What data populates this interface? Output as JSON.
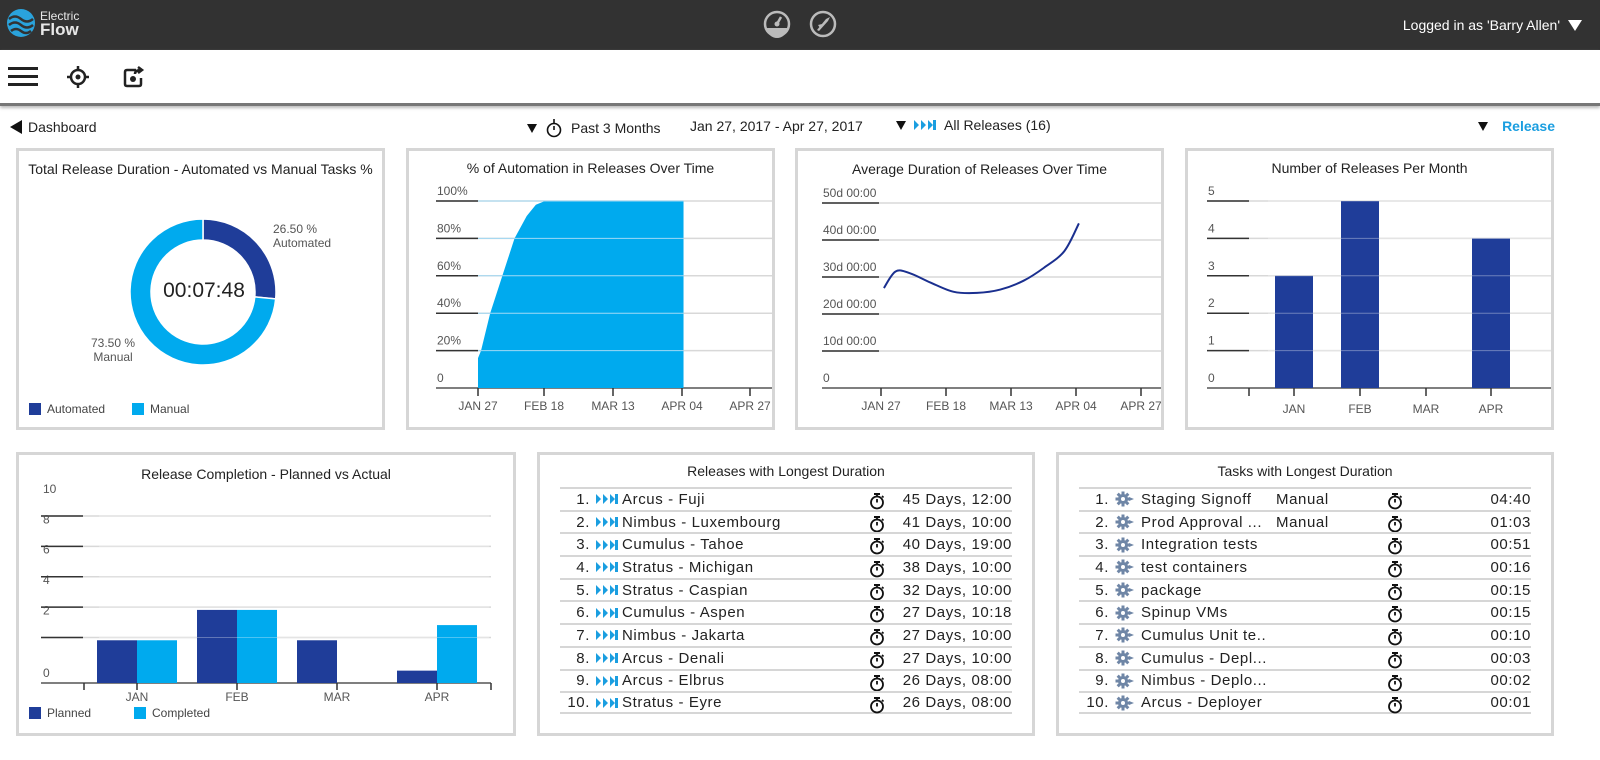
{
  "app": {
    "logo_line1": "Electric",
    "logo_line2": "Flow",
    "user_label": "Logged in as 'Barry Allen'",
    "top_icons": [
      "dashboard-gauge-icon",
      "release-rocket-icon"
    ],
    "toolbar_icons": [
      "menu-icon",
      "target-icon",
      "refresh-icon"
    ]
  },
  "colors": {
    "dark": "#1f3d99",
    "light": "#00aaee",
    "accent": "#1a9ee0",
    "topbar": "#323232"
  },
  "filters": {
    "back_label": "Dashboard",
    "time_range": "Past 3 Months",
    "date_range": "Jan 27, 2017 - Apr 27, 2017",
    "releases_filter": "All Releases (16)",
    "group_by": "Release"
  },
  "panels": {
    "donut": {
      "title": "Total Release Duration - Automated vs Manual Tasks %",
      "center_text": "00:07:48",
      "automated_label_pct": "26.50 %",
      "automated_label": "Automated",
      "manual_label_pct": "73.50 %",
      "manual_label": "Manual",
      "legend": [
        "Automated",
        "Manual"
      ]
    },
    "automation": {
      "title": "% of Automation in Releases Over Time"
    },
    "avg_duration": {
      "title": "Average Duration of Releases Over Time"
    },
    "per_month": {
      "title": "Number of Releases Per Month"
    },
    "completion": {
      "title": "Release Completion - Planned vs Actual",
      "legend": [
        "Planned",
        "Completed"
      ]
    },
    "longest_releases": {
      "title": "Releases with Longest Duration",
      "rows": [
        {
          "n": "1.",
          "name": "Arcus - Fuji",
          "duration": "45 Days, 12:00"
        },
        {
          "n": "2.",
          "name": "Nimbus - Luxembourg",
          "duration": "41 Days, 10:00"
        },
        {
          "n": "3.",
          "name": "Cumulus - Tahoe",
          "duration": "40 Days, 19:00"
        },
        {
          "n": "4.",
          "name": "Stratus - Michigan",
          "duration": "38 Days, 10:00"
        },
        {
          "n": "5.",
          "name": "Stratus - Caspian",
          "duration": "32 Days, 10:00"
        },
        {
          "n": "6.",
          "name": "Cumulus - Aspen",
          "duration": "27 Days, 10:18"
        },
        {
          "n": "7.",
          "name": "Nimbus - Jakarta",
          "duration": "27 Days, 10:00"
        },
        {
          "n": "8.",
          "name": "Arcus - Denali",
          "duration": "27 Days, 10:00"
        },
        {
          "n": "9.",
          "name": "Arcus - Elbrus",
          "duration": "26 Days, 08:00"
        },
        {
          "n": "10.",
          "name": "Stratus - Eyre",
          "duration": "26 Days, 08:00"
        }
      ]
    },
    "longest_tasks": {
      "title": "Tasks with Longest Duration",
      "rows": [
        {
          "n": "1.",
          "name": "Staging Signoff",
          "type": "Manual",
          "duration": "04:40"
        },
        {
          "n": "2.",
          "name": "Prod Approval ...",
          "type": "Manual",
          "duration": "01:03"
        },
        {
          "n": "3.",
          "name": "Integration tests",
          "type": "",
          "duration": "00:51"
        },
        {
          "n": "4.",
          "name": "test containers",
          "type": "",
          "duration": "00:16"
        },
        {
          "n": "5.",
          "name": "package",
          "type": "",
          "duration": "00:15"
        },
        {
          "n": "6.",
          "name": "Spinup VMs",
          "type": "",
          "duration": "00:15"
        },
        {
          "n": "7.",
          "name": "Cumulus Unit te..",
          "type": "",
          "duration": "00:10"
        },
        {
          "n": "8.",
          "name": "Cumulus - Depl...",
          "type": "",
          "duration": "00:03"
        },
        {
          "n": "9.",
          "name": "Nimbus - Deplo...",
          "type": "",
          "duration": "00:02"
        },
        {
          "n": "10.",
          "name": "Arcus - Deployer",
          "type": "",
          "duration": "00:01"
        }
      ]
    }
  },
  "chart_data": [
    {
      "type": "pie",
      "title": "Total Release Duration - Automated vs Manual Tasks %",
      "categories": [
        "Automated",
        "Manual"
      ],
      "values": [
        26.5,
        73.5
      ],
      "center_label": "00:07:48",
      "legend": "bottom-left"
    },
    {
      "type": "area",
      "title": "% of Automation in Releases Over Time",
      "x_ticks": [
        "JAN 27",
        "FEB 18",
        "MAR 13",
        "APR 04",
        "APR 27"
      ],
      "y_ticks": [
        "0",
        "20%",
        "40%",
        "60%",
        "80%",
        "100%"
      ],
      "ylim": [
        0,
        100
      ],
      "x_days": [
        0,
        1,
        4,
        8,
        12,
        16,
        19,
        22,
        67.5
      ],
      "values": [
        16,
        20,
        40,
        60,
        80,
        92,
        98,
        100,
        100
      ],
      "grid": true
    },
    {
      "type": "line",
      "title": "Average Duration of Releases Over Time",
      "x_ticks": [
        "JAN 27",
        "FEB 18",
        "MAR 13",
        "APR 04",
        "APR 27"
      ],
      "y_ticks": [
        "0",
        "10d 00:00",
        "20d 00:00",
        "30d 00:00",
        "40d 00:00",
        "50d 00:00"
      ],
      "ylim": [
        0,
        50
      ],
      "x_days": [
        1,
        5,
        10,
        17,
        25,
        33,
        41,
        49,
        56,
        63,
        68
      ],
      "values": [
        27,
        31.5,
        31,
        28.5,
        26,
        25.7,
        26.6,
        29,
        32.5,
        37,
        44.5
      ],
      "grid": true
    },
    {
      "type": "bar",
      "title": "Number of Releases Per Month",
      "categories": [
        "JAN",
        "FEB",
        "MAR",
        "APR"
      ],
      "values": [
        3,
        5,
        0,
        4
      ],
      "y_ticks": [
        "0",
        "1",
        "2",
        "3",
        "4",
        "5"
      ],
      "ylim": [
        0,
        5
      ],
      "grid": true
    },
    {
      "type": "bar",
      "title": "Release Completion - Planned vs Actual",
      "categories": [
        "JAN",
        "FEB",
        "MAR",
        "APR"
      ],
      "series": [
        {
          "name": "Planned",
          "values": [
            3,
            5,
            3,
            1
          ]
        },
        {
          "name": "Completed",
          "values": [
            3,
            5,
            0,
            4
          ]
        }
      ],
      "y_ticks": [
        "0",
        "2",
        "4",
        "6",
        "8",
        "10"
      ],
      "ylim": [
        -1,
        10
      ],
      "legend": "bottom-left",
      "grid": true
    }
  ]
}
